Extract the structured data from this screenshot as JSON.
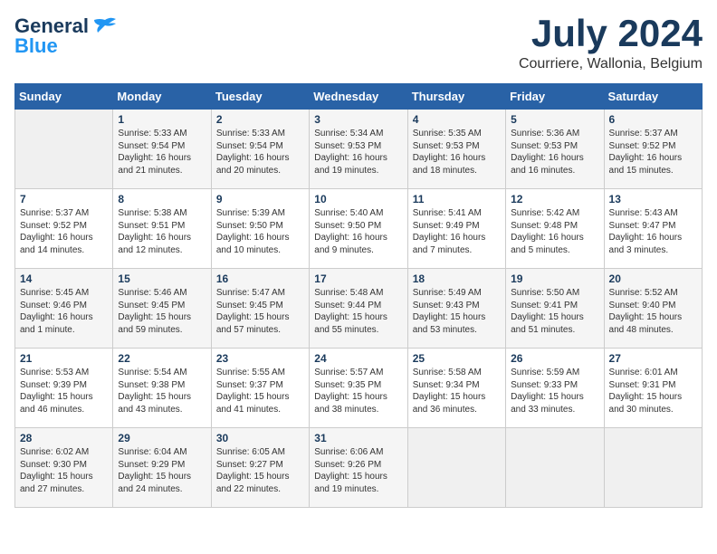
{
  "header": {
    "logo_general": "General",
    "logo_blue": "Blue",
    "month": "July 2024",
    "location": "Courriere, Wallonia, Belgium"
  },
  "days_of_week": [
    "Sunday",
    "Monday",
    "Tuesday",
    "Wednesday",
    "Thursday",
    "Friday",
    "Saturday"
  ],
  "weeks": [
    [
      {
        "day": "",
        "text": ""
      },
      {
        "day": "1",
        "text": "Sunrise: 5:33 AM\nSunset: 9:54 PM\nDaylight: 16 hours\nand 21 minutes."
      },
      {
        "day": "2",
        "text": "Sunrise: 5:33 AM\nSunset: 9:54 PM\nDaylight: 16 hours\nand 20 minutes."
      },
      {
        "day": "3",
        "text": "Sunrise: 5:34 AM\nSunset: 9:53 PM\nDaylight: 16 hours\nand 19 minutes."
      },
      {
        "day": "4",
        "text": "Sunrise: 5:35 AM\nSunset: 9:53 PM\nDaylight: 16 hours\nand 18 minutes."
      },
      {
        "day": "5",
        "text": "Sunrise: 5:36 AM\nSunset: 9:53 PM\nDaylight: 16 hours\nand 16 minutes."
      },
      {
        "day": "6",
        "text": "Sunrise: 5:37 AM\nSunset: 9:52 PM\nDaylight: 16 hours\nand 15 minutes."
      }
    ],
    [
      {
        "day": "7",
        "text": "Sunrise: 5:37 AM\nSunset: 9:52 PM\nDaylight: 16 hours\nand 14 minutes."
      },
      {
        "day": "8",
        "text": "Sunrise: 5:38 AM\nSunset: 9:51 PM\nDaylight: 16 hours\nand 12 minutes."
      },
      {
        "day": "9",
        "text": "Sunrise: 5:39 AM\nSunset: 9:50 PM\nDaylight: 16 hours\nand 10 minutes."
      },
      {
        "day": "10",
        "text": "Sunrise: 5:40 AM\nSunset: 9:50 PM\nDaylight: 16 hours\nand 9 minutes."
      },
      {
        "day": "11",
        "text": "Sunrise: 5:41 AM\nSunset: 9:49 PM\nDaylight: 16 hours\nand 7 minutes."
      },
      {
        "day": "12",
        "text": "Sunrise: 5:42 AM\nSunset: 9:48 PM\nDaylight: 16 hours\nand 5 minutes."
      },
      {
        "day": "13",
        "text": "Sunrise: 5:43 AM\nSunset: 9:47 PM\nDaylight: 16 hours\nand 3 minutes."
      }
    ],
    [
      {
        "day": "14",
        "text": "Sunrise: 5:45 AM\nSunset: 9:46 PM\nDaylight: 16 hours\nand 1 minute."
      },
      {
        "day": "15",
        "text": "Sunrise: 5:46 AM\nSunset: 9:45 PM\nDaylight: 15 hours\nand 59 minutes."
      },
      {
        "day": "16",
        "text": "Sunrise: 5:47 AM\nSunset: 9:45 PM\nDaylight: 15 hours\nand 57 minutes."
      },
      {
        "day": "17",
        "text": "Sunrise: 5:48 AM\nSunset: 9:44 PM\nDaylight: 15 hours\nand 55 minutes."
      },
      {
        "day": "18",
        "text": "Sunrise: 5:49 AM\nSunset: 9:43 PM\nDaylight: 15 hours\nand 53 minutes."
      },
      {
        "day": "19",
        "text": "Sunrise: 5:50 AM\nSunset: 9:41 PM\nDaylight: 15 hours\nand 51 minutes."
      },
      {
        "day": "20",
        "text": "Sunrise: 5:52 AM\nSunset: 9:40 PM\nDaylight: 15 hours\nand 48 minutes."
      }
    ],
    [
      {
        "day": "21",
        "text": "Sunrise: 5:53 AM\nSunset: 9:39 PM\nDaylight: 15 hours\nand 46 minutes."
      },
      {
        "day": "22",
        "text": "Sunrise: 5:54 AM\nSunset: 9:38 PM\nDaylight: 15 hours\nand 43 minutes."
      },
      {
        "day": "23",
        "text": "Sunrise: 5:55 AM\nSunset: 9:37 PM\nDaylight: 15 hours\nand 41 minutes."
      },
      {
        "day": "24",
        "text": "Sunrise: 5:57 AM\nSunset: 9:35 PM\nDaylight: 15 hours\nand 38 minutes."
      },
      {
        "day": "25",
        "text": "Sunrise: 5:58 AM\nSunset: 9:34 PM\nDaylight: 15 hours\nand 36 minutes."
      },
      {
        "day": "26",
        "text": "Sunrise: 5:59 AM\nSunset: 9:33 PM\nDaylight: 15 hours\nand 33 minutes."
      },
      {
        "day": "27",
        "text": "Sunrise: 6:01 AM\nSunset: 9:31 PM\nDaylight: 15 hours\nand 30 minutes."
      }
    ],
    [
      {
        "day": "28",
        "text": "Sunrise: 6:02 AM\nSunset: 9:30 PM\nDaylight: 15 hours\nand 27 minutes."
      },
      {
        "day": "29",
        "text": "Sunrise: 6:04 AM\nSunset: 9:29 PM\nDaylight: 15 hours\nand 24 minutes."
      },
      {
        "day": "30",
        "text": "Sunrise: 6:05 AM\nSunset: 9:27 PM\nDaylight: 15 hours\nand 22 minutes."
      },
      {
        "day": "31",
        "text": "Sunrise: 6:06 AM\nSunset: 9:26 PM\nDaylight: 15 hours\nand 19 minutes."
      },
      {
        "day": "",
        "text": ""
      },
      {
        "day": "",
        "text": ""
      },
      {
        "day": "",
        "text": ""
      }
    ]
  ]
}
